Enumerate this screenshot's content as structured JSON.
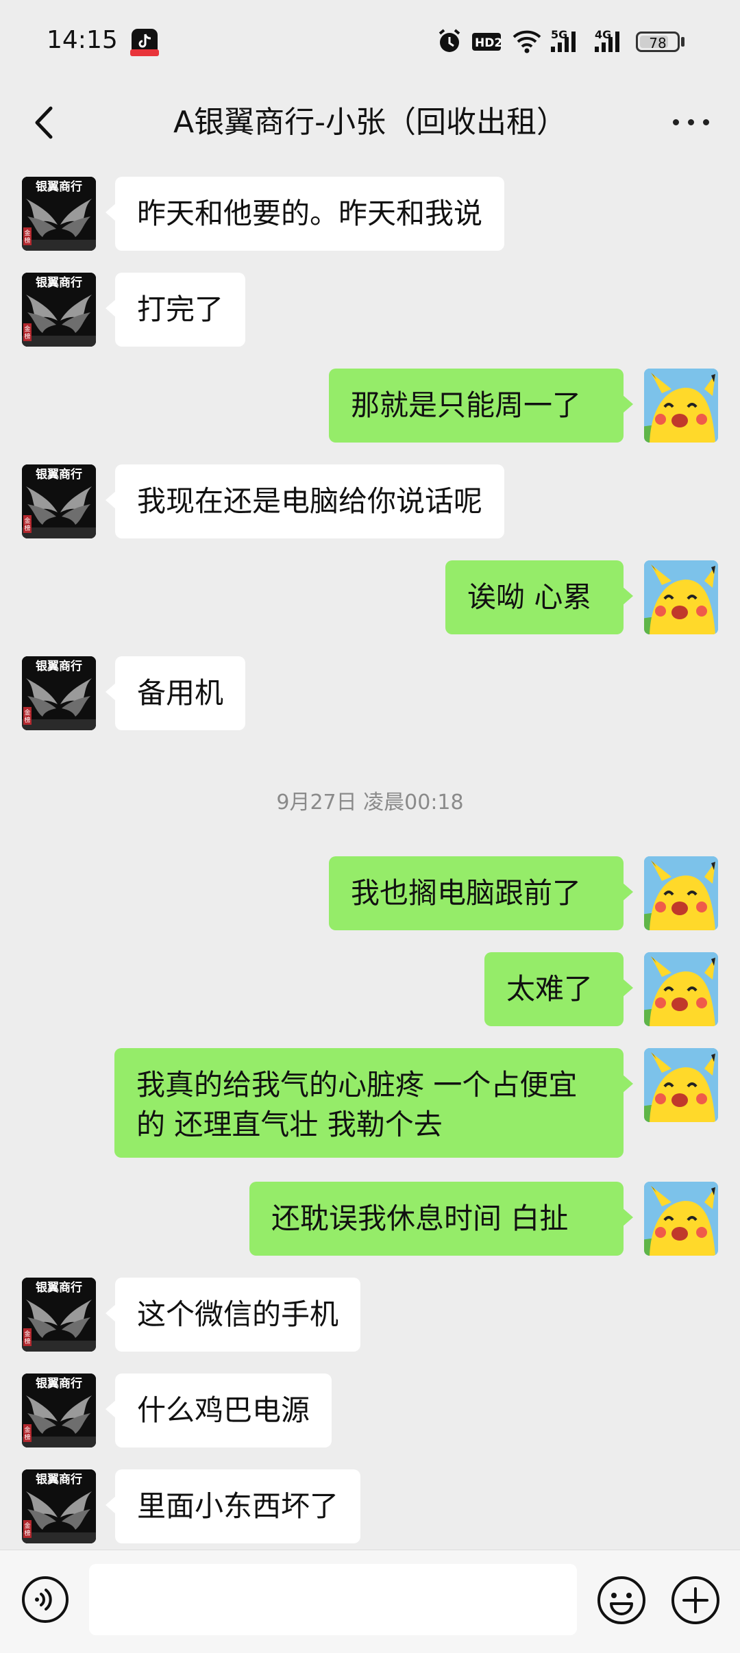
{
  "status_bar": {
    "time": "14:15",
    "battery": "78",
    "battery_level": 78,
    "network_1": "5G",
    "network_2": "4G",
    "hd": "HD2"
  },
  "header": {
    "title": "A银翼商行-小张（回收出租）"
  },
  "contact_avatar": {
    "text_top": "银翼商行",
    "text_side": "金榜"
  },
  "messages": [
    {
      "side": "left",
      "text": "昨天和他要的。昨天和我说"
    },
    {
      "side": "left",
      "text": "打完了"
    },
    {
      "side": "right",
      "text": "那就是只能周一了"
    },
    {
      "side": "left",
      "text": "我现在还是电脑给你说话呢"
    },
    {
      "side": "right",
      "text": "诶呦 心累"
    },
    {
      "side": "left",
      "text": "备用机"
    },
    {
      "side": "right",
      "text": "我也搁电脑跟前了"
    },
    {
      "side": "right",
      "text": "太难了"
    },
    {
      "side": "right",
      "text": "我真的给我气的心脏疼  一个占便宜的  还理直气壮  我勒个去"
    },
    {
      "side": "right",
      "text": "还耽误我休息时间  白扯"
    },
    {
      "side": "left",
      "text": "这个微信的手机"
    },
    {
      "side": "left",
      "text": "什么鸡巴电源"
    },
    {
      "side": "left",
      "text": "里面小东西坏了"
    }
  ],
  "timestamp": "9月27日 凌晨00:18",
  "input": {
    "value": "",
    "placeholder": ""
  },
  "colors": {
    "background": "#ededed",
    "outgoing_bubble": "#95ec69",
    "incoming_bubble": "#ffffff"
  }
}
